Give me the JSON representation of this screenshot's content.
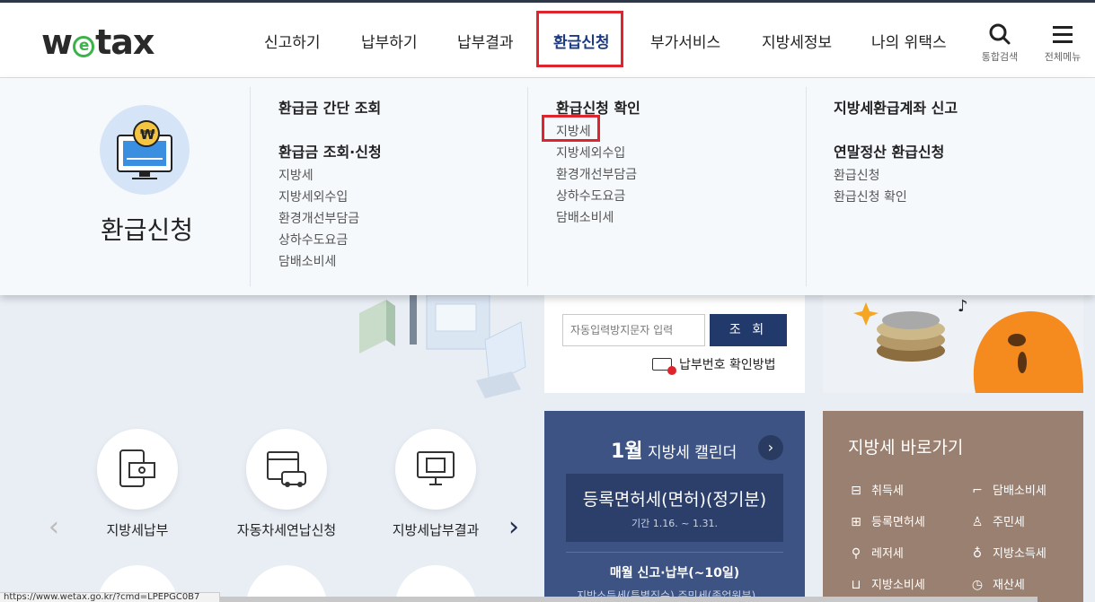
{
  "logo": {
    "pre": "w",
    "e": "e",
    "post": "tax"
  },
  "gnb": [
    {
      "label": "신고하기"
    },
    {
      "label": "납부하기"
    },
    {
      "label": "납부결과"
    },
    {
      "label": "환급신청"
    },
    {
      "label": "부가서비스"
    },
    {
      "label": "지방세정보"
    },
    {
      "label": "나의 위택스"
    }
  ],
  "util": {
    "search_label": "통합검색",
    "menu_label": "전체메뉴"
  },
  "mega": {
    "title": "환급신청",
    "col1": {
      "heading1": "환급금 간단 조회",
      "heading2": "환급금 조회·신청",
      "items": [
        "지방세",
        "지방세외수입",
        "환경개선부담금",
        "상하수도요금",
        "담배소비세"
      ]
    },
    "col2": {
      "heading": "환급신청 확인",
      "items": [
        "지방세",
        "지방세외수입",
        "환경개선부담금",
        "상하수도요금",
        "담배소비세"
      ]
    },
    "col3": {
      "heading1": "지방세환급계좌 신고",
      "heading2": "연말정산 환급신청",
      "items": [
        "환급신청",
        "환급신청 확인"
      ]
    }
  },
  "lookup": {
    "captcha_placeholder": "자동입력방지문자 입력",
    "button_label": "조 회",
    "method_label": "납부번호 확인방법"
  },
  "calendar": {
    "month": "1월",
    "title": "지방세 캘린더",
    "next": "›",
    "card_title": "등록면허세(면허)(정기분)",
    "card_period": "기간 1.16. ~ 1.31.",
    "monthly": "매월 신고·납부(~10일)",
    "sub": "지방소득세(특별징수)   주민세(종업원분)"
  },
  "shortcut": {
    "title": "지방세 바로가기",
    "items": [
      {
        "label": "취득세",
        "icon": "briefcase-icon"
      },
      {
        "label": "담배소비세",
        "icon": "cigarette-icon"
      },
      {
        "label": "등록면허세",
        "icon": "plus-box-icon"
      },
      {
        "label": "주민세",
        "icon": "person-icon"
      },
      {
        "label": "레저세",
        "icon": "bicycle-icon"
      },
      {
        "label": "지방소득세",
        "icon": "money-bag-icon"
      },
      {
        "label": "지방소비세",
        "icon": "cart-icon"
      },
      {
        "label": "재산세",
        "icon": "clock-icon"
      }
    ]
  },
  "services": [
    {
      "label": "지방세납부"
    },
    {
      "label": "자동차세연납신청"
    },
    {
      "label": "지방세납부결과"
    }
  ],
  "arrows": {
    "prev": "‹",
    "next": "›"
  },
  "status_url": "https://www.wetax.go.kr/?cmd=LPEPGC0B7"
}
